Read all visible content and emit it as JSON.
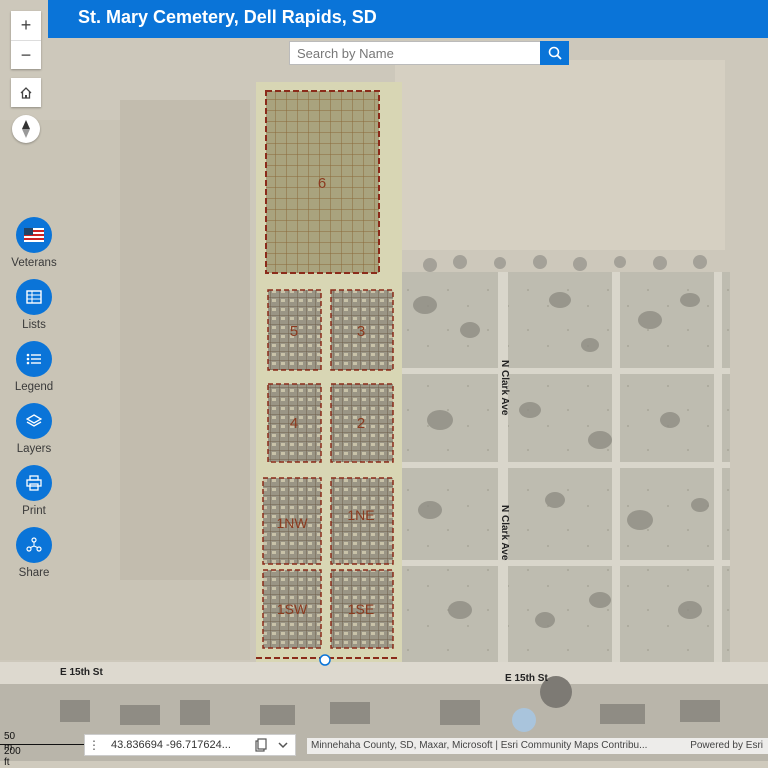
{
  "app": {
    "title": "St. Mary Cemetery, Dell Rapids, SD"
  },
  "search": {
    "placeholder": "Search by Name"
  },
  "nav": {
    "zoom_in": "+",
    "zoom_out": "−"
  },
  "tools": [
    {
      "label": "Veterans",
      "icon": "flag-icon"
    },
    {
      "label": "Lists",
      "icon": "table-icon"
    },
    {
      "label": "Legend",
      "icon": "legend-icon"
    },
    {
      "label": "Layers",
      "icon": "layers-icon"
    },
    {
      "label": "Print",
      "icon": "printer-icon"
    },
    {
      "label": "Share",
      "icon": "share-icon"
    }
  ],
  "map": {
    "sections": [
      "6",
      "5",
      "3",
      "4",
      "2",
      "1NW",
      "1NE",
      "1SW",
      "1SE"
    ],
    "streets": {
      "east_15th_left": "E 15th St",
      "east_15th_right": "E 15th St",
      "n_clark_upper": "N Clark Ave",
      "n_clark_lower": "N Clark Ave"
    }
  },
  "scale": {
    "metric": "50 m",
    "imperial": "200 ft"
  },
  "coordinates": {
    "value": "43.836694 -96.717624..."
  },
  "attribution": {
    "text": "Minnehaha County, SD, Maxar, Microsoft | Esri Community Maps Contribu...",
    "powered": "Powered by Esri"
  },
  "colors": {
    "accent": "#0a74d8",
    "section_border": "#8b2b1a",
    "section_fill": "#b8b06a"
  }
}
